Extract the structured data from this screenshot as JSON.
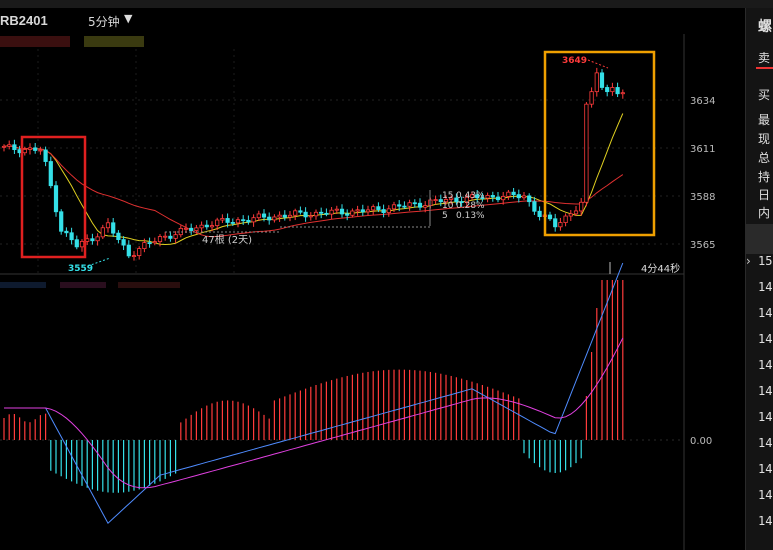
{
  "header": {
    "symbol": "RB2401",
    "period": "5分钟",
    "period_arrow": "▼"
  },
  "price_axis": {
    "ticks": [
      3634,
      3611,
      3588,
      3565
    ]
  },
  "macd_axis": {
    "zero_label": "0.00"
  },
  "annotations": {
    "low_price": "3559",
    "high_price": "3649",
    "bar_count": "47根 (2天)",
    "countdown": "4分44秒",
    "ma_labels": [
      {
        "period": "15",
        "pct": "0.43%"
      },
      {
        "period": "10",
        "pct": "0.28%"
      },
      {
        "period": "5",
        "pct": "0.13%"
      }
    ]
  },
  "highlight_colors": {
    "left_box": "#e02020",
    "right_box": "#f0a000"
  },
  "colors": {
    "up": "#ff3b3b",
    "down": "#35e0e8",
    "ma_short": "#e0d020",
    "ma_long": "#e03030",
    "dif": "#4f8cff",
    "dea": "#e040e0"
  },
  "right_panel": {
    "title": "螺",
    "tabs": [
      "卖"
    ],
    "rows": [
      "买",
      "最",
      "现",
      "总",
      "持",
      "日",
      "内"
    ],
    "times": [
      "15",
      "14",
      "14",
      "14",
      "14",
      "14",
      "14",
      "14",
      "14",
      "14",
      "14"
    ]
  }
}
